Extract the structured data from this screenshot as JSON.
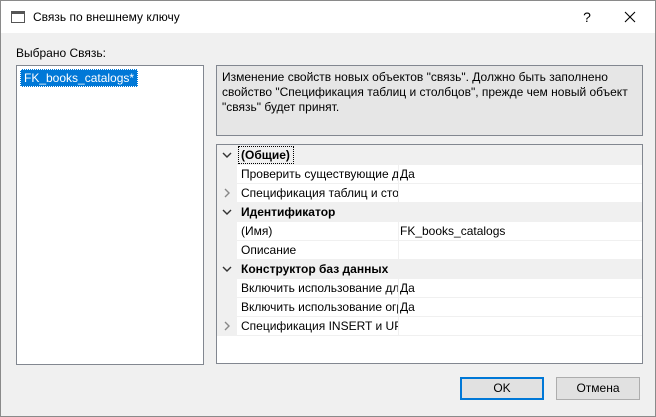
{
  "window": {
    "title": "Связь по внешнему ключу",
    "help_label": "?"
  },
  "left_panel": {
    "label": "Выбрано Связь:",
    "items": [
      "FK_books_catalogs*"
    ]
  },
  "description": "Изменение свойств новых объектов \"связь\".  Должно быть заполнено свойство \"Спецификация таблиц и столбцов\", прежде чем новый объект \"связь\" будет принят.",
  "properties": [
    {
      "type": "category",
      "name": "(Общие)",
      "expand": "down"
    },
    {
      "type": "prop",
      "name": "Проверить существующие данные при создании или повторном включении",
      "value": "Да"
    },
    {
      "type": "prop",
      "name": "Спецификация таблиц и столбцов",
      "value": "",
      "expand": "right"
    },
    {
      "type": "category",
      "name": "Идентификатор",
      "expand": "down"
    },
    {
      "type": "prop",
      "name": "(Имя)",
      "value": "FK_books_catalogs"
    },
    {
      "type": "prop",
      "name": "Описание",
      "value": ""
    },
    {
      "type": "category",
      "name": "Конструктор баз данных",
      "expand": "down"
    },
    {
      "type": "prop",
      "name": "Включить использование для репликации",
      "value": "Да"
    },
    {
      "type": "prop",
      "name": "Включить использование ограничения внешнего ключа",
      "value": "Да"
    },
    {
      "type": "prop",
      "name": "Спецификация INSERT и UPDATE",
      "value": "",
      "expand": "right"
    }
  ],
  "buttons": {
    "ok": "OK",
    "cancel": "Отмена"
  }
}
